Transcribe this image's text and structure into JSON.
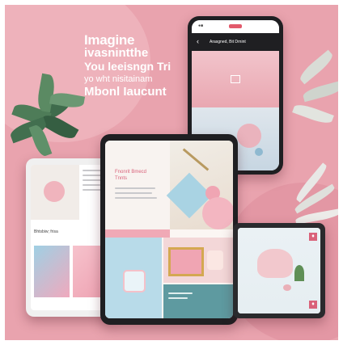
{
  "headline": {
    "line1": "Imagine",
    "line2": "ivasnintthe",
    "line3": "You leeisngn Tri",
    "line4": "yo wht nisitainam",
    "line5": "Mbonl Iaucunt"
  },
  "phone": {
    "status_left": "●■",
    "nav_title": "Arasgned, Bit Drnint"
  },
  "tablet_left": {
    "caption": "Bhtsbiw; frisa"
  },
  "tablet_center": {
    "title_line1": "Fnonrit Bmecd",
    "title_line2": "Tnnts"
  },
  "icon_badge": "♦",
  "colors": {
    "background": "#e9a3ae",
    "accent_pink": "#e8a0ae",
    "light_blue": "#a9d3e3",
    "cream": "#f4ecdf"
  }
}
